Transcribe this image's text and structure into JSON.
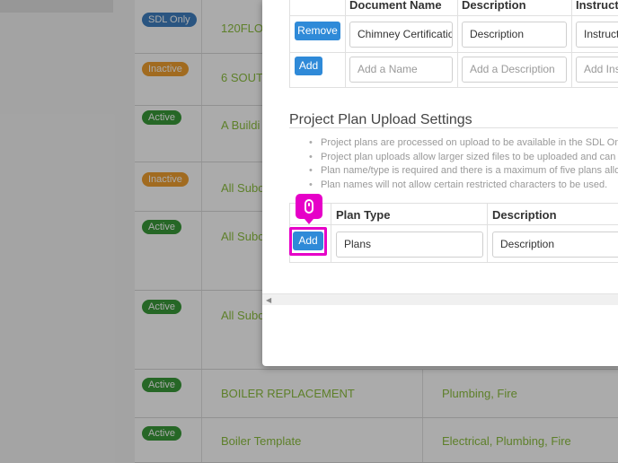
{
  "background_list": {
    "rows": [
      {
        "badge": "SDL Only",
        "badge_type": "sdl",
        "name": "120FLO",
        "trade": ""
      },
      {
        "badge": "Inactive",
        "badge_type": "inactive",
        "name": "6 SOUT",
        "trade": ""
      },
      {
        "badge": "Active",
        "badge_type": "active",
        "name": "A Buildi",
        "trade": ""
      },
      {
        "badge": "Inactive",
        "badge_type": "inactive",
        "name": "All Subc",
        "trade": ""
      },
      {
        "badge": "Active",
        "badge_type": "active",
        "name": "All Subc",
        "trade": ""
      },
      {
        "badge": "Active",
        "badge_type": "active",
        "name": "All Subc",
        "trade": ""
      },
      {
        "badge": "Active",
        "badge_type": "active",
        "name": "BOILER REPLACEMENT",
        "trade": "Plumbing, Fire"
      },
      {
        "badge": "Active",
        "badge_type": "active",
        "name": "Boiler Template",
        "trade": "Electrical, Plumbing, Fire"
      }
    ]
  },
  "documents": {
    "headers": {
      "document_name": "Document Name",
      "description": "Description",
      "instructions": "Instruct"
    },
    "row": {
      "remove_label": "Remove",
      "name_value": "Chimney Certificatio",
      "description_value": "Description",
      "instructions_value": "Instruct"
    },
    "new_row": {
      "add_label": "Add",
      "name_placeholder": "Add a Name",
      "description_placeholder": "Add a Description",
      "instructions_placeholder": "Add Ins"
    }
  },
  "plan_upload": {
    "title": "Project Plan Upload Settings",
    "notes": [
      "Project plans are processed on upload to be available in the SDL Onli",
      "Project plan uploads allow larger sized files to be uploaded and can o",
      "Plan name/type is required and there is a maximum of five plans allow",
      "Plan names will not allow certain restricted characters to be used."
    ],
    "headers": {
      "plan_type": "Plan Type",
      "description": "Description"
    },
    "add_label": "Add",
    "plan_type_value": "Plans",
    "description_value": "Description"
  },
  "tutorial": {
    "icon": "mouse-icon",
    "highlight_color": "#e600c8"
  },
  "colors": {
    "button": "#2f8ad8",
    "active_badge": "#3a9a3a",
    "inactive_badge": "#f0a030",
    "sdl_badge": "#3f7fc0",
    "link_text": "#8cbf3f"
  }
}
